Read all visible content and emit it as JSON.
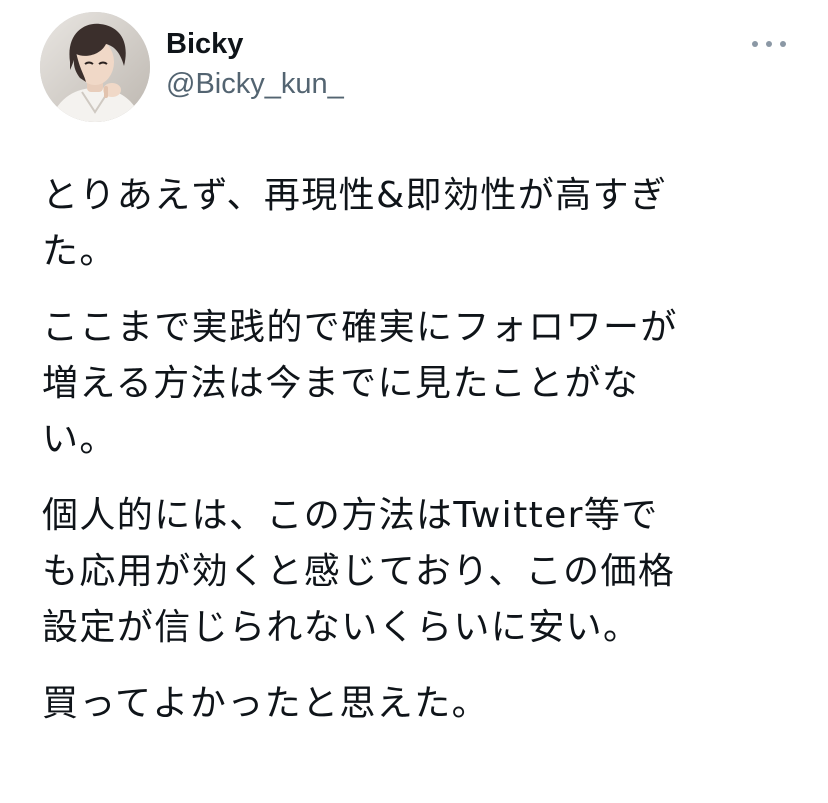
{
  "author": {
    "display_name": "Bicky",
    "handle": "@Bicky_kun_"
  },
  "icons": {
    "more": "more-horizontal-icon",
    "avatar": "avatar-image"
  },
  "colors": {
    "text": "#0f1419",
    "secondary": "#536471",
    "icon": "#8b98a5",
    "background": "#ffffff"
  },
  "tweet": {
    "paragraphs": [
      "とりあえず、再現性&即効性が高すぎ\nた。",
      "ここまで実践的で確実にフォロワーが\n増える方法は今までに見たことがな\nい。",
      "個人的には、この方法はTwitter等で\nも応用が効くと感じており、この価格\n設定が信じられないくらいに安い。",
      "買ってよかったと思えた。"
    ]
  }
}
